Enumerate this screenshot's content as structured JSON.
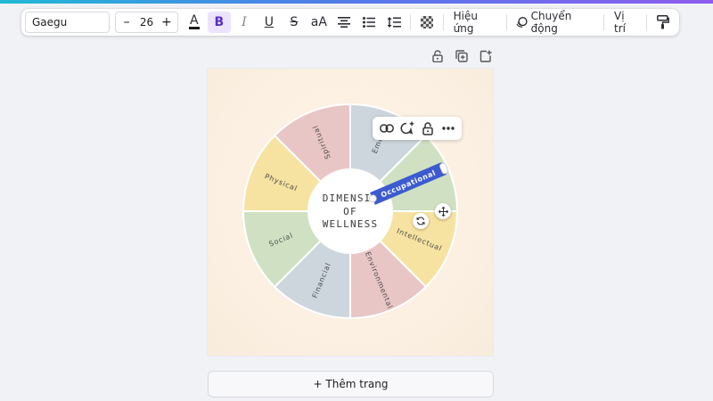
{
  "toolbar": {
    "font_name": "Gaegu",
    "font_size": "26",
    "minus_label": "–",
    "plus_label": "+",
    "text_color_glyph": "A",
    "bold_glyph": "B",
    "italic_glyph": "I",
    "underline_glyph": "U",
    "strike_glyph": "S",
    "case_glyph": "aA",
    "effects_label": "Hiệu ứng",
    "animate_label": "Chuyển động",
    "position_label": "Vị trí"
  },
  "wheel": {
    "center_lines": [
      "DIMENSIO",
      "OF",
      "WELLNESS"
    ],
    "segments": [
      {
        "label": "Spiritual",
        "color": "#e9c6c6"
      },
      {
        "label": "Emoti",
        "color": "#cdd6dd"
      },
      {
        "label": "Occupational",
        "color": "#cfe1c2"
      },
      {
        "label": "Intellectual",
        "color": "#f7e3a1"
      },
      {
        "label": "Environmental",
        "color": "#e9c6c6"
      },
      {
        "label": "Financial",
        "color": "#cdd6dd"
      },
      {
        "label": "Social",
        "color": "#cfe1c2"
      },
      {
        "label": "Physical",
        "color": "#f7e3a1"
      }
    ]
  },
  "selected_text": "Occupational",
  "colors": {
    "accent": "#8e5cf0",
    "selection": "#3c5bd0"
  },
  "add_page_label": "+ Thêm trang"
}
